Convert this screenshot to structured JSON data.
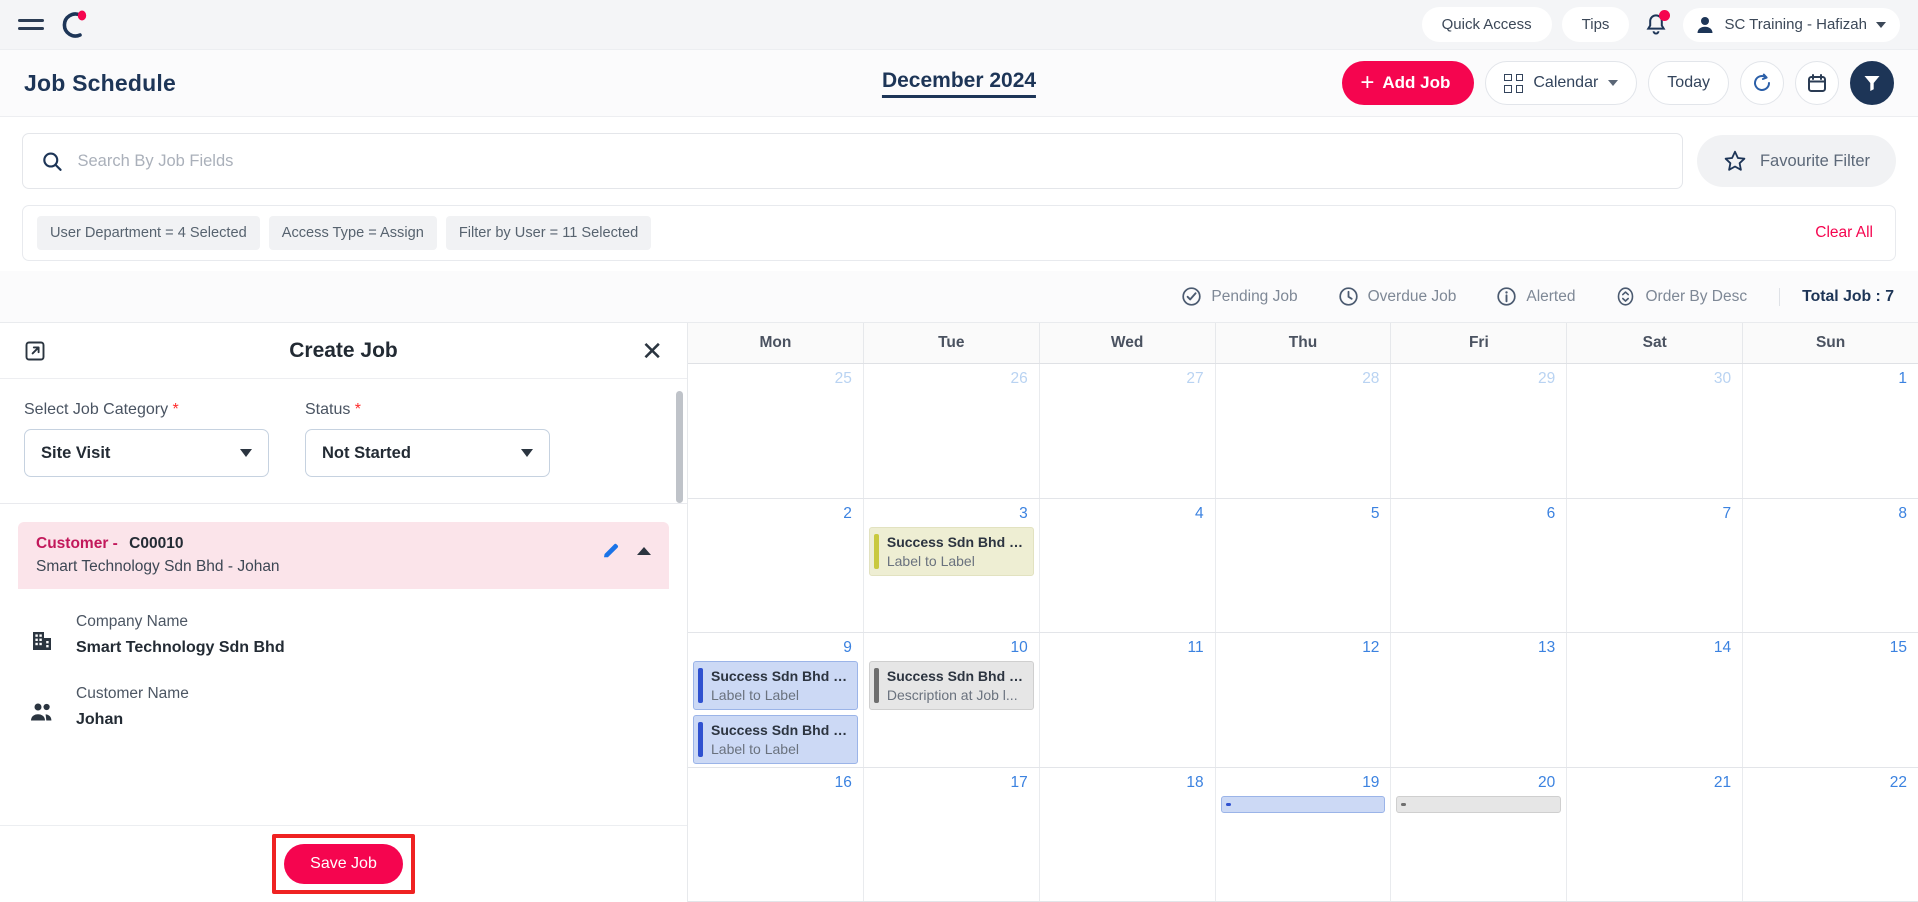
{
  "topbar": {
    "quick_access": "Quick Access",
    "tips": "Tips",
    "user": "SC Training - Hafizah"
  },
  "header": {
    "title": "Job Schedule",
    "month": "December 2024",
    "add_job": "Add Job",
    "view_mode": "Calendar",
    "today": "Today"
  },
  "search": {
    "placeholder": "Search By Job Fields",
    "value": "",
    "favourite_filter": "Favourite Filter"
  },
  "filters": {
    "chips": [
      "User Department  =  4 Selected",
      "Access Type  =  Assign",
      "Filter by User  =  11 Selected"
    ],
    "clear_all": "Clear All"
  },
  "status": {
    "items": [
      {
        "label": "Pending Job",
        "icon": "check-circle-icon"
      },
      {
        "label": "Overdue Job",
        "icon": "clock-icon"
      },
      {
        "label": "Alerted",
        "icon": "info-icon"
      },
      {
        "label": "Order By Desc",
        "icon": "sort-icon"
      }
    ],
    "total_label": "Total Job :",
    "total_value": "7"
  },
  "panel": {
    "title": "Create Job",
    "job_category_label": "Select Job Category",
    "job_category_value": "Site Visit",
    "status_label": "Status",
    "status_value": "Not Started",
    "customer_header_label": "Customer -",
    "customer_code": "C00010",
    "customer_subtitle": "Smart Technology Sdn Bhd - Johan",
    "fields": [
      {
        "icon": "building-icon",
        "label": "Company Name",
        "value": "Smart Technology Sdn Bhd"
      },
      {
        "icon": "people-icon",
        "label": "Customer Name",
        "value": "Johan"
      }
    ],
    "save_label": "Save Job"
  },
  "calendar": {
    "day_headers": [
      "Mon",
      "Tue",
      "Wed",
      "Thu",
      "Fri",
      "Sat",
      "Sun"
    ],
    "weeks": [
      {
        "days": [
          {
            "num": "25",
            "muted": true,
            "events": []
          },
          {
            "num": "26",
            "muted": true,
            "events": []
          },
          {
            "num": "27",
            "muted": true,
            "events": []
          },
          {
            "num": "28",
            "muted": true,
            "events": []
          },
          {
            "num": "29",
            "muted": true,
            "events": []
          },
          {
            "num": "30",
            "muted": true,
            "events": []
          },
          {
            "num": "1",
            "muted": false,
            "events": []
          }
        ]
      },
      {
        "days": [
          {
            "num": "2",
            "muted": false,
            "events": []
          },
          {
            "num": "3",
            "muted": false,
            "events": [
              {
                "title": "Success Sdn Bhd - J...",
                "sub": "Label to Label",
                "color": "yellow"
              }
            ]
          },
          {
            "num": "4",
            "muted": false,
            "events": []
          },
          {
            "num": "5",
            "muted": false,
            "events": []
          },
          {
            "num": "6",
            "muted": false,
            "events": []
          },
          {
            "num": "7",
            "muted": false,
            "events": []
          },
          {
            "num": "8",
            "muted": false,
            "events": []
          }
        ]
      },
      {
        "days": [
          {
            "num": "9",
            "muted": false,
            "events": [
              {
                "title": "Success Sdn Bhd - J...",
                "sub": "Label to Label",
                "color": "blue"
              },
              {
                "title": "Success Sdn Bhd - J...",
                "sub": "Label to Label",
                "color": "blue"
              }
            ]
          },
          {
            "num": "10",
            "muted": false,
            "events": [
              {
                "title": "Success Sdn Bhd - J...",
                "sub": "Description at Job l...",
                "color": "grey"
              }
            ]
          },
          {
            "num": "11",
            "muted": false,
            "events": []
          },
          {
            "num": "12",
            "muted": false,
            "events": []
          },
          {
            "num": "13",
            "muted": false,
            "events": []
          },
          {
            "num": "14",
            "muted": false,
            "events": []
          },
          {
            "num": "15",
            "muted": false,
            "events": []
          }
        ]
      },
      {
        "days": [
          {
            "num": "16",
            "muted": false,
            "events": []
          },
          {
            "num": "17",
            "muted": false,
            "events": []
          },
          {
            "num": "18",
            "muted": false,
            "events": []
          },
          {
            "num": "19",
            "muted": false,
            "events": [
              {
                "title": "",
                "sub": "",
                "color": "blue"
              }
            ]
          },
          {
            "num": "20",
            "muted": false,
            "events": [
              {
                "title": "",
                "sub": "",
                "color": "grey"
              }
            ]
          },
          {
            "num": "21",
            "muted": false,
            "events": []
          },
          {
            "num": "22",
            "muted": false,
            "events": []
          }
        ]
      }
    ]
  }
}
